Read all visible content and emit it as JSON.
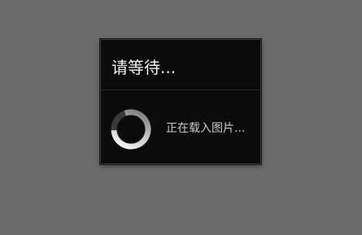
{
  "dialog": {
    "title": "请等待...",
    "message": "正在载入图片...",
    "spinner_icon": "loading-spinner-icon"
  },
  "colors": {
    "backdrop": "#6b6b6b",
    "dialog_background": "#0b0b0b",
    "title_text": "#f2f2f2",
    "message_text": "#c8c8c8"
  }
}
